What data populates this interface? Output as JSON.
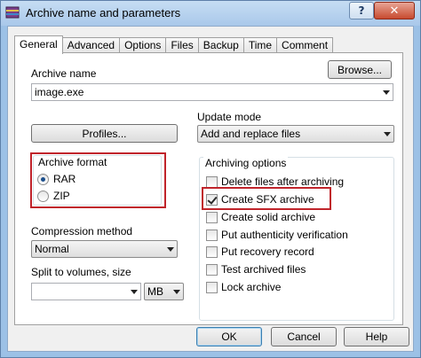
{
  "window": {
    "title": "Archive name and parameters",
    "help_label": "?",
    "close_label": "✕"
  },
  "tabs": [
    {
      "label": "General",
      "active": true
    },
    {
      "label": "Advanced"
    },
    {
      "label": "Options"
    },
    {
      "label": "Files"
    },
    {
      "label": "Backup"
    },
    {
      "label": "Time"
    },
    {
      "label": "Comment"
    }
  ],
  "general": {
    "archive_name_label": "Archive name",
    "archive_name_value": "image.exe",
    "browse_label": "Browse...",
    "profiles_label": "Profiles...",
    "update_mode_label": "Update mode",
    "update_mode_value": "Add and replace files",
    "archive_format_title": "Archive format",
    "format_options": [
      {
        "label": "RAR",
        "selected": true
      },
      {
        "label": "ZIP",
        "selected": false
      }
    ],
    "compression_method_label": "Compression method",
    "compression_method_value": "Normal",
    "split_label": "Split to volumes, size",
    "split_value": "",
    "split_unit": "MB",
    "archiving_options_title": "Archiving options",
    "archiving_options": [
      {
        "label": "Delete files after archiving",
        "checked": false
      },
      {
        "label": "Create SFX archive",
        "checked": true
      },
      {
        "label": "Create solid archive",
        "checked": false
      },
      {
        "label": "Put authenticity verification",
        "checked": false
      },
      {
        "label": "Put recovery record",
        "checked": false
      },
      {
        "label": "Test archived files",
        "checked": false
      },
      {
        "label": "Lock archive",
        "checked": false
      }
    ]
  },
  "buttons": {
    "ok": "OK",
    "cancel": "Cancel",
    "help": "Help"
  },
  "colors": {
    "highlight": "#c0242b",
    "title_bar": "#a9c8ea"
  }
}
